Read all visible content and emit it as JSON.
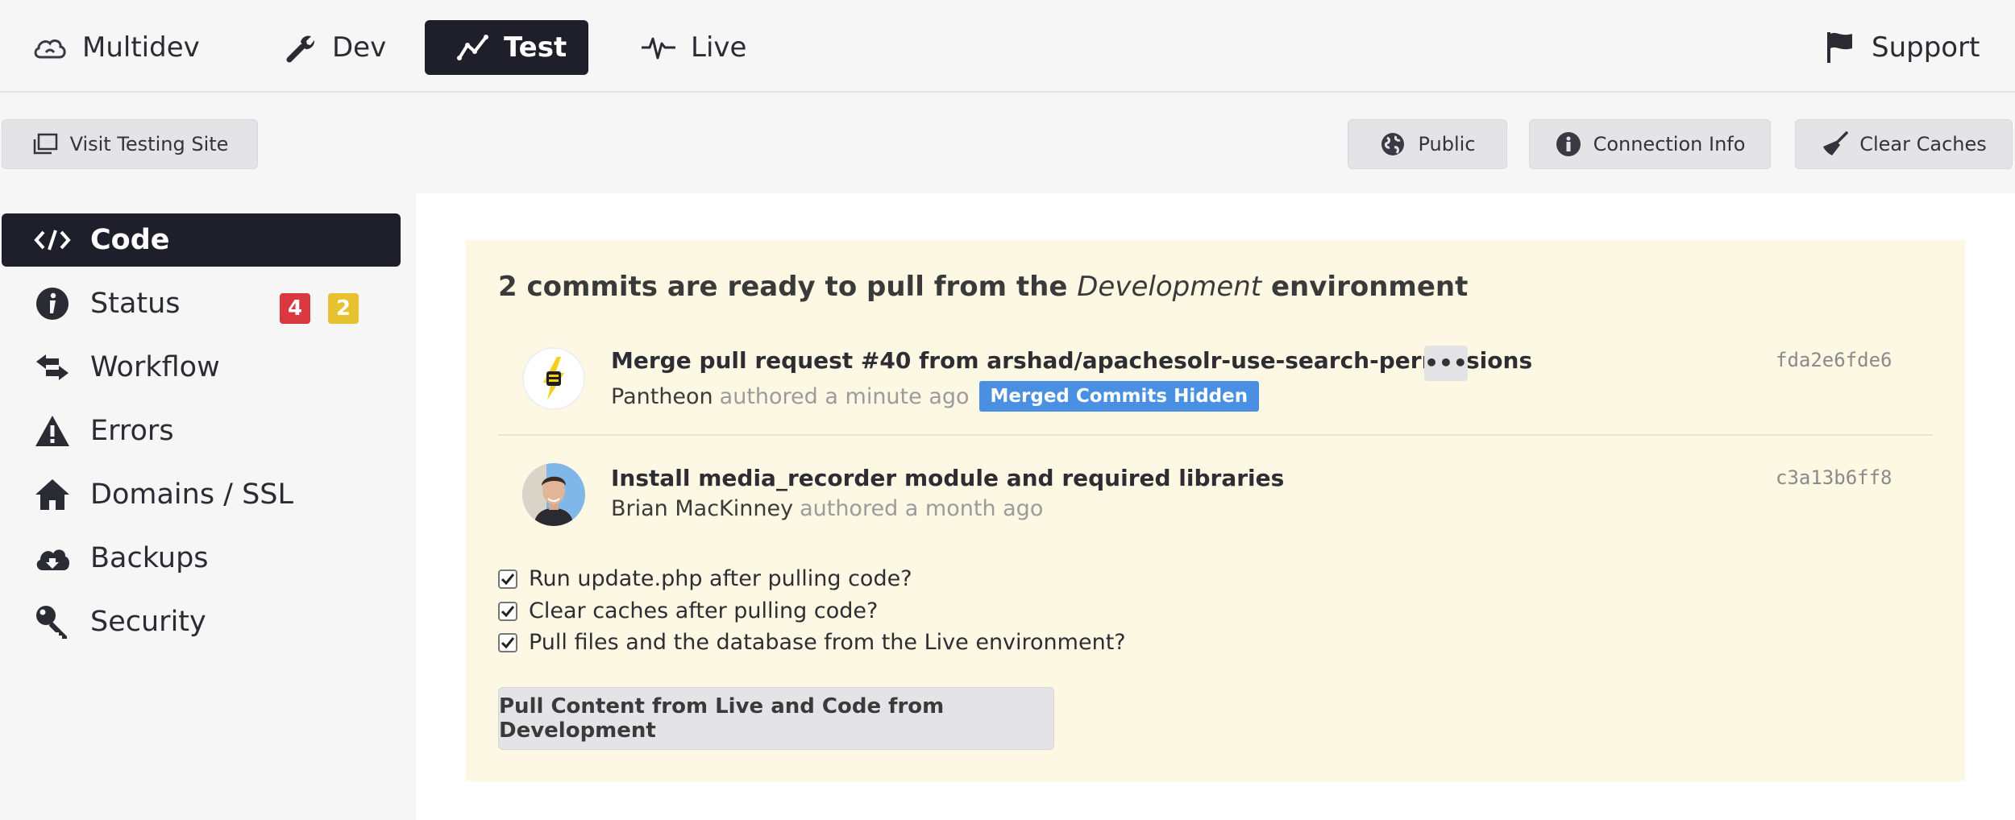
{
  "env_tabs": [
    {
      "label": "Multidev",
      "icon": "cloud-icon",
      "active": false
    },
    {
      "label": "Dev",
      "icon": "wrench-icon",
      "active": false
    },
    {
      "label": "Test",
      "icon": "chart-line-icon",
      "active": true
    },
    {
      "label": "Live",
      "icon": "pulse-icon",
      "active": false
    }
  ],
  "support": {
    "label": "Support",
    "icon": "flag-icon"
  },
  "toolbar": {
    "visit_label": "Visit Testing Site",
    "public_label": "Public",
    "connection_label": "Connection Info",
    "clear_label": "Clear Caches"
  },
  "sidebar": {
    "items": [
      {
        "label": "Code",
        "icon": "code-icon",
        "active": true
      },
      {
        "label": "Status",
        "icon": "info-icon",
        "badges": [
          "4",
          "2"
        ]
      },
      {
        "label": "Workflow",
        "icon": "arrows-icon"
      },
      {
        "label": "Errors",
        "icon": "warning-icon"
      },
      {
        "label": "Domains / SSL",
        "icon": "home-icon"
      },
      {
        "label": "Backups",
        "icon": "cloud-download-icon"
      },
      {
        "label": "Security",
        "icon": "key-icon"
      }
    ]
  },
  "notice": {
    "heading_pre": "2 commits are ready to pull from the",
    "heading_env": "Development",
    "heading_post": "environment",
    "commits": [
      {
        "title": "Merge pull request #40 from arshad/apachesolr-use-search-permissions",
        "author": "Pantheon",
        "when": "authored a minute ago",
        "badge": "Merged Commits Hidden",
        "more": "•••",
        "hash": "fda2e6fde6"
      },
      {
        "title": "Install media_recorder module and required libraries",
        "author": "Brian MacKinney",
        "when": "authored a month ago",
        "hash": "c3a13b6ff8"
      }
    ],
    "options": [
      {
        "label": "Run update.php after pulling code?",
        "checked": true
      },
      {
        "label": "Clear caches after pulling code?",
        "checked": true
      },
      {
        "label": "Pull files and the database from the Live environment?",
        "checked": true
      }
    ],
    "button_label": "Pull Content from Live and Code from Development"
  },
  "colors": {
    "dark": "#1f1f2b",
    "notice_bg": "#fcf8e3",
    "badge_red": "#d9383e",
    "badge_yellow": "#e8c12f",
    "merged_blue": "#4a90e2"
  }
}
